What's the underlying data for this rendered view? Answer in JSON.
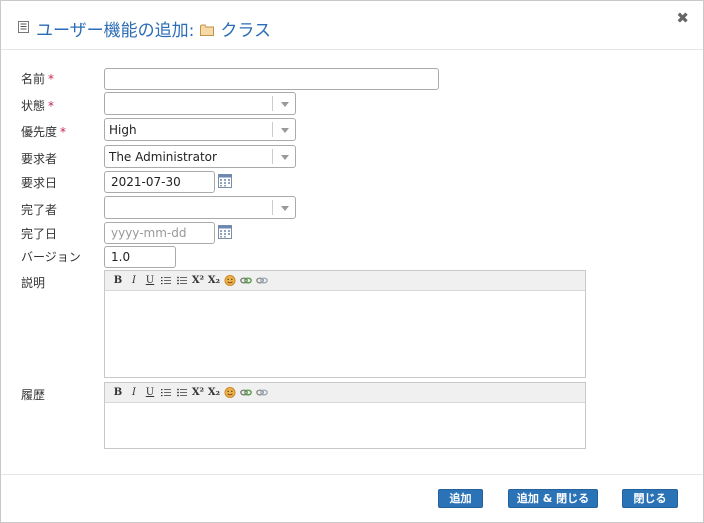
{
  "dialog": {
    "title": "ユーザー機能の追加:",
    "target": "クラス"
  },
  "fields": {
    "name": {
      "label": "名前",
      "value": ""
    },
    "status": {
      "label": "状態",
      "value": ""
    },
    "priority": {
      "label": "優先度",
      "value": "High"
    },
    "requester": {
      "label": "要求者",
      "value": "The Administrator"
    },
    "request_date": {
      "label": "要求日",
      "value": "2021-07-30"
    },
    "completed_by": {
      "label": "完了者",
      "value": ""
    },
    "completion_date": {
      "label": "完了日",
      "value": "",
      "placeholder": "yyyy-mm-dd"
    },
    "version": {
      "label": "バージョン",
      "value": "1.0"
    },
    "description": {
      "label": "説明"
    },
    "history": {
      "label": "履歴"
    }
  },
  "required_mark": "*",
  "toolbar": {
    "bold": "B",
    "italic": "I",
    "underline": "U",
    "superscript": "X²",
    "subscript": "X₂"
  },
  "buttons": {
    "add": "追加",
    "add_close": "追加 & 閉じる",
    "close": "閉じる"
  },
  "colors": {
    "title": "#2a6cb5",
    "button": "#2b73b7",
    "required": "#c7254e"
  }
}
